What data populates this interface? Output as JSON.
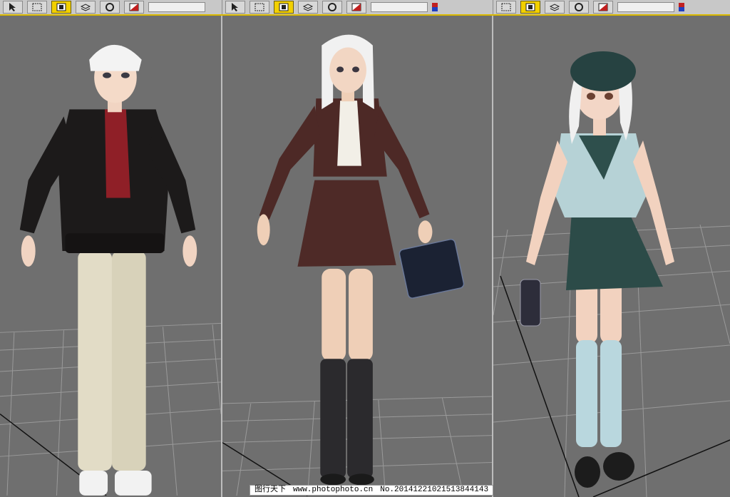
{
  "toolbar": {
    "segments": [
      {
        "buttons": [
          "select-object",
          "select-region",
          "render-frame",
          "layer-manager",
          "curve-editor",
          "material-editor"
        ]
      },
      {
        "buttons": [
          "select-object",
          "select-region",
          "render-frame",
          "layer-manager",
          "curve-editor",
          "material-editor"
        ]
      },
      {
        "buttons": [
          "select-object",
          "select-region",
          "render-frame",
          "layer-manager",
          "curve-editor",
          "material-editor"
        ]
      }
    ],
    "active_color": "#f2d000"
  },
  "viewports": [
    {
      "name": "viewport-left",
      "character": "boy in black jacket, red shirt, beige pants, white sneakers"
    },
    {
      "name": "viewport-center",
      "character": "girl in brown school blazer, pleated skirt, black knee socks, holding briefcase"
    },
    {
      "name": "viewport-right",
      "character": "girl in green beret, sailor uniform, teal skirt, light blue stockings, holding camera"
    }
  ],
  "watermark": {
    "site_label": "图行天下",
    "url": "www.photophoto.cn",
    "number": "No.20141221021513844143"
  },
  "colors": {
    "viewport_bg": "#6f6f6f",
    "grid": "#9a9a9a",
    "toolbar_bg": "#c8c8c8",
    "accent": "#d9b800"
  }
}
